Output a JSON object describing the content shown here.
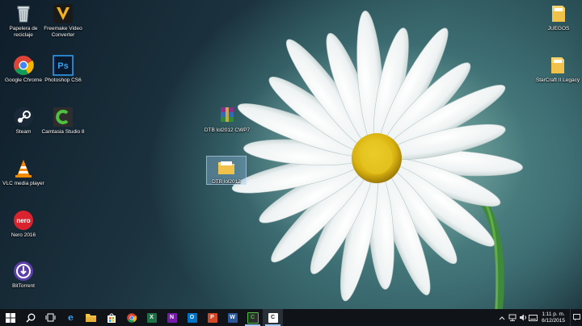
{
  "desktop": {
    "icons": [
      {
        "label": "Papelera de reciclaje"
      },
      {
        "label": "Freemake Video Converter"
      },
      {
        "label": "Google Chrome"
      },
      {
        "label": "Photoshop CS6"
      },
      {
        "label": "Steam"
      },
      {
        "label": "Camtasia Studio 8"
      },
      {
        "label": "VLC media player"
      },
      {
        "label": "Nero 2016"
      },
      {
        "label": "BitTorrent"
      },
      {
        "label": "DTB lol2012 CWP7"
      },
      {
        "label": "DTB lol2012"
      },
      {
        "label": "JUEGOS"
      },
      {
        "label": "StarCraft II Legacy"
      }
    ]
  },
  "taskbar": {
    "apps": [
      {
        "icon": "start-icon"
      },
      {
        "icon": "search-icon"
      },
      {
        "icon": "task-view-icon"
      },
      {
        "icon": "edge-icon",
        "letter": "e"
      },
      {
        "icon": "file-explorer-icon"
      },
      {
        "icon": "store-icon"
      },
      {
        "icon": "chrome-icon"
      },
      {
        "icon": "excel-icon",
        "letter": "X"
      },
      {
        "icon": "onenote-icon",
        "letter": "N"
      },
      {
        "icon": "outlook-icon",
        "letter": "O"
      },
      {
        "icon": "powerpoint-icon",
        "letter": "P"
      },
      {
        "icon": "word-icon",
        "letter": "W"
      },
      {
        "icon": "camtasia-icon",
        "letter": "C"
      },
      {
        "icon": "camtasia-recorder-icon",
        "letter": "C"
      }
    ],
    "time": "1:11 p. m.",
    "date": "6/12/2015"
  },
  "colors": {
    "taskbar": "#101418",
    "excel": "#1e7145",
    "onenote": "#7719aa",
    "outlook": "#0072c6",
    "powerpoint": "#d24726",
    "word": "#2b579a",
    "camtasia": "#3a9a3a"
  }
}
